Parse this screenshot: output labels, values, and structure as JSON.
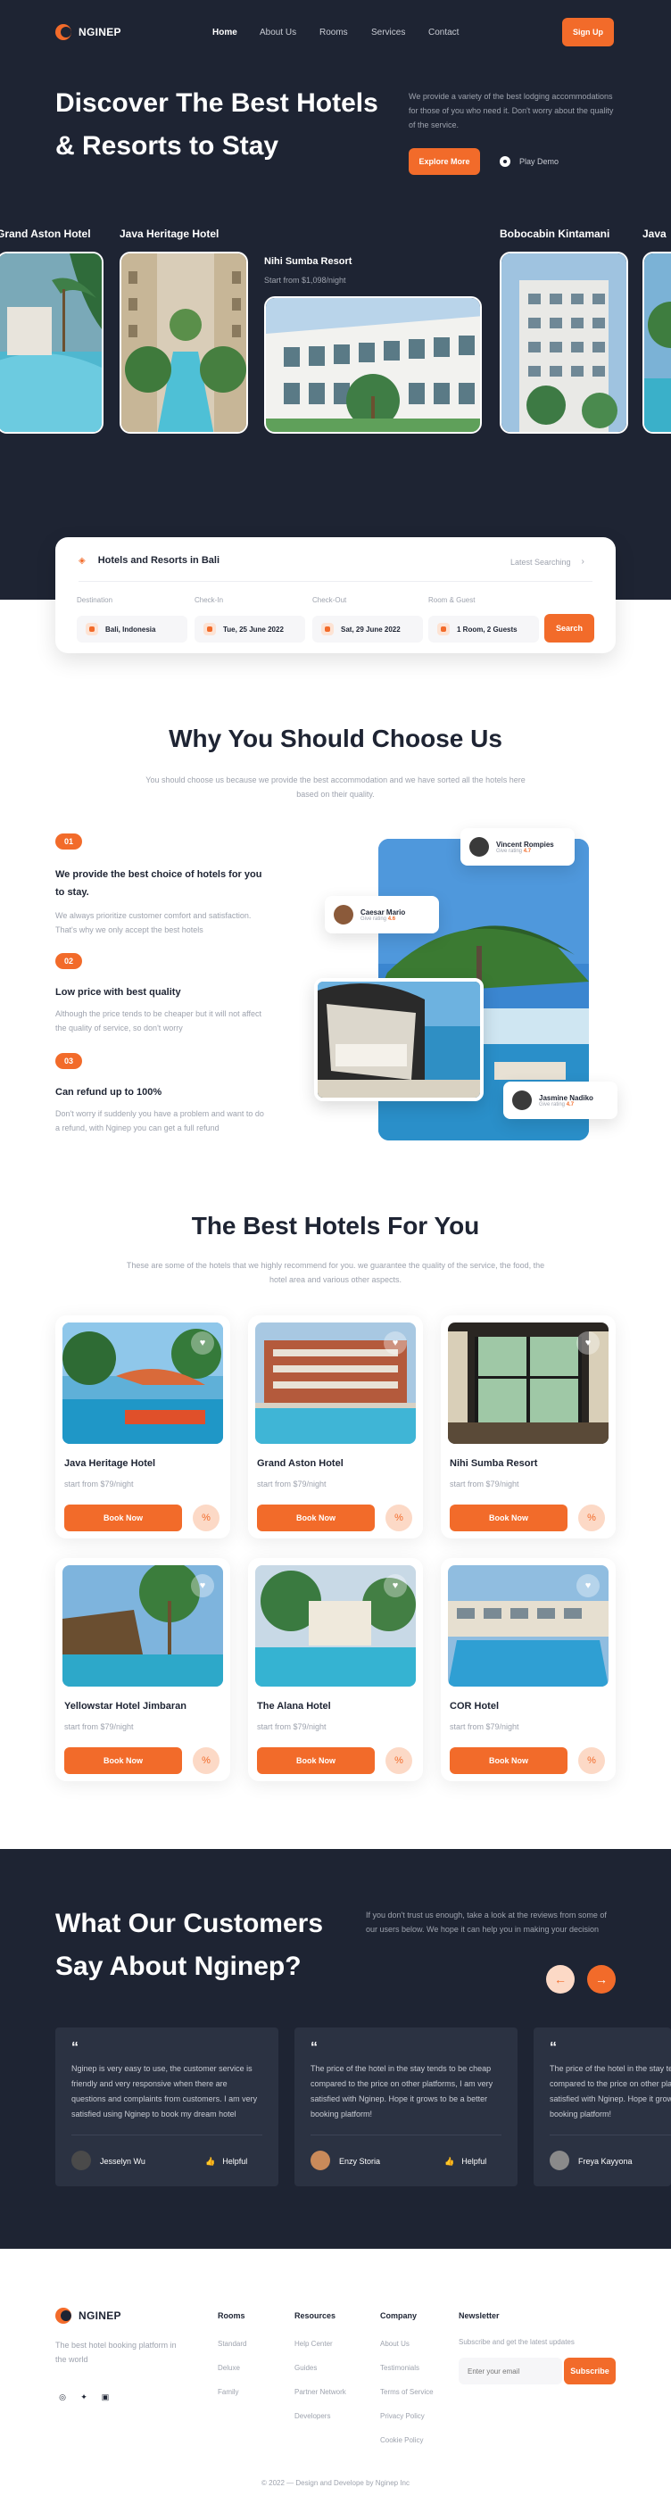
{
  "brand": {
    "name": "NGINEP"
  },
  "nav": {
    "home": "Home",
    "about": "About Us",
    "rooms": "Rooms",
    "services": "Services",
    "contact": "Contact",
    "signup": "Sign Up"
  },
  "hero": {
    "title_line1": "Discover The Best Hotels",
    "title_line2": "& Resorts to Stay",
    "description": "We provide a variety of the best lodging accommodations for those of you who need it. Don't worry about the quality of the service.",
    "explore": "Explore More",
    "play": "Play Demo"
  },
  "carousel": [
    {
      "name": "Grand Aston Hotel"
    },
    {
      "name": "Java Heritage Hotel"
    },
    {
      "name": "Nihi Sumba Resort",
      "price": "Start from $1,098/night"
    },
    {
      "name": "Bobocabin Kintamani"
    },
    {
      "name": "Java"
    }
  ],
  "search": {
    "tab": "Hotels and Resorts in Bali",
    "latest": "Latest Searching",
    "destination_label": "Destination",
    "destination": "Bali, Indonesia",
    "checkin_label": "Check-In",
    "checkin": "Tue, 25 June 2022",
    "checkout_label": "Check-Out",
    "checkout": "Sat, 29 June 2022",
    "rooms_label": "Room & Guest",
    "rooms": "1 Room, 2 Guests",
    "button": "Search"
  },
  "why": {
    "title": "Why You Should Choose Us",
    "subtitle": "You should choose us because we provide the best accommodation and we have sorted all the hotels here based on their quality.",
    "items": [
      {
        "num": "01",
        "title": "We provide the best choice of hotels for you to stay.",
        "text": "We always prioritize customer comfort and satisfaction. That's why we only accept the best hotels"
      },
      {
        "num": "02",
        "title": "Low price with best quality",
        "text": "Although the price tends to be cheaper but it will not affect the quality of service, so don't worry"
      },
      {
        "num": "03",
        "title": "Can refund up to 100%",
        "text": "Don't worry if suddenly you have a problem and want to do a refund, with Nginep you can get a full refund"
      }
    ],
    "reviewers": [
      {
        "name": "Vincent Rompies",
        "rating_label": "Give rating",
        "rating": "4.7"
      },
      {
        "name": "Caesar Mario",
        "rating_label": "Give rating",
        "rating": "4.6"
      },
      {
        "name": "Jasmine Nadiko",
        "rating_label": "Give rating",
        "rating": "4.7"
      }
    ]
  },
  "best": {
    "title": "The Best Hotels For You",
    "subtitle": "These are some of the hotels that we highly recommend for you. we guarantee the quality of the service, the food, the hotel area and various other aspects.",
    "book": "Book Now",
    "hotels": [
      {
        "name": "Java Heritage Hotel",
        "price": "start from $79/night"
      },
      {
        "name": "Grand Aston Hotel",
        "price": "start from $79/night"
      },
      {
        "name": "Nihi Sumba Resort",
        "price": "start from $79/night"
      },
      {
        "name": "Yellowstar Hotel Jimbaran",
        "price": "start from $79/night"
      },
      {
        "name": "The Alana Hotel",
        "price": "start from $79/night"
      },
      {
        "name": "COR Hotel",
        "price": "start from $79/night"
      }
    ]
  },
  "testimonials": {
    "title_line1": "What Our Customers",
    "title_line2": "Say About Nginep?",
    "description": "If you don't trust us enough, take a look at the reviews from some of our users below.  We hope it can help you in making your decision",
    "helpful": "Helpful",
    "reviews": [
      {
        "text": "Nginep is very easy to use, the customer service is friendly and very responsive when there are questions and complaints from customers. I am very satisfied using Nginep to book my dream hotel",
        "name": "Jesselyn Wu"
      },
      {
        "text": "The price of the hotel in the stay tends to be cheap compared to the price on other platforms, I am very satisfied with Nginep. Hope it grows to be a better booking platform!",
        "name": "Enzy Storia"
      },
      {
        "text": "The price of the hotel in the stay tends to be cheap compared to the price on other platforms, I am very satisfied with Nginep. Hope it grows to be a better booking platform!",
        "name": "Freya Kayyona"
      }
    ]
  },
  "footer": {
    "tagline": "The best hotel booking platform in the world",
    "rooms_h": "Rooms",
    "rooms": [
      "Standard",
      "Deluxe",
      "Family"
    ],
    "resources_h": "Resources",
    "resources": [
      "Help Center",
      "Guides",
      "Partner Network",
      "Developers"
    ],
    "company_h": "Company",
    "company": [
      "About Us",
      "Testimonials",
      "Terms of Service",
      "Privacy Policy",
      "Cookie Policy"
    ],
    "newsletter_h": "Newsletter",
    "newsletter_text": "Subscribe and get the latest updates",
    "email_placeholder": "Enter your email",
    "subscribe": "Subscribe",
    "copyright": "© 2022 — Design and Develope by Nginep Inc"
  },
  "colors": {
    "accent": "#f26b2a",
    "dark": "#1e2433",
    "card_dark": "#2b3242"
  }
}
